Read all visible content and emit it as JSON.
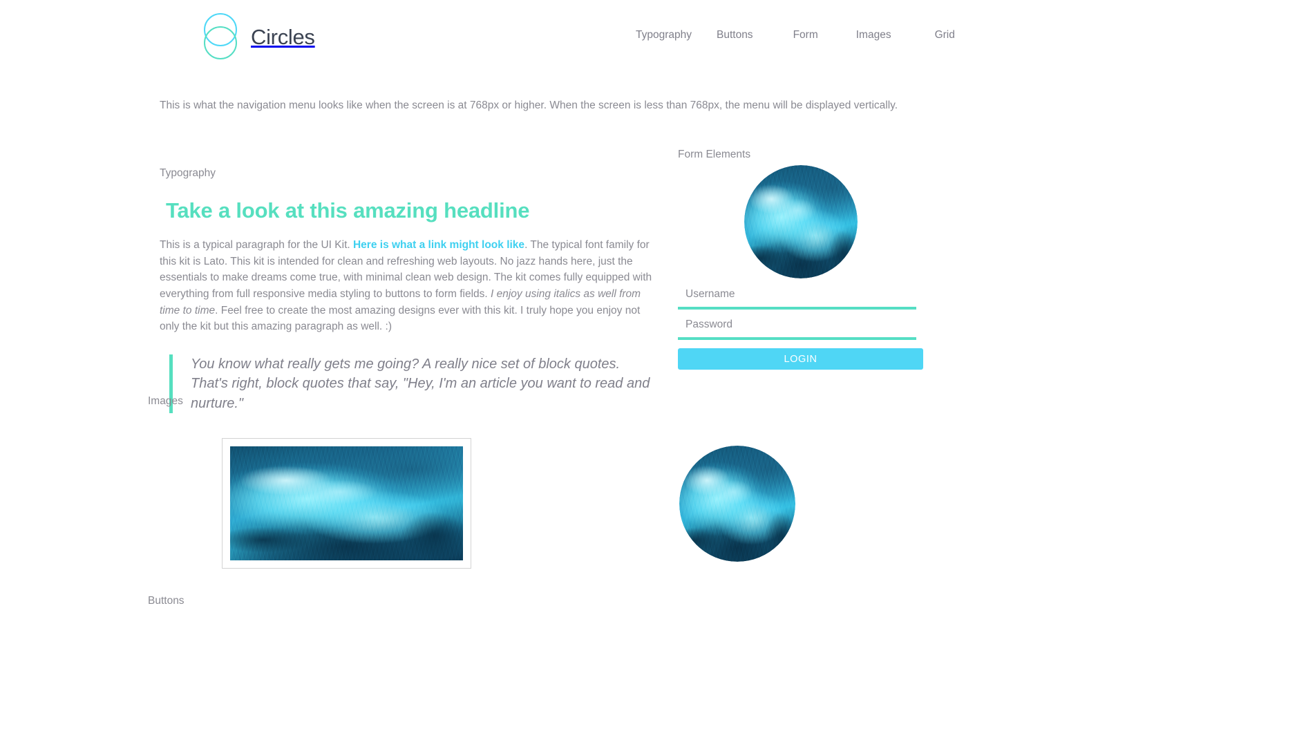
{
  "brand": {
    "name": "Circles",
    "logo_icon": "two-overlapping-circles-icon",
    "logo_top_color": "#4ed8f7",
    "logo_bottom_color": "#55dec4"
  },
  "nav": {
    "items": [
      {
        "label": "Typography"
      },
      {
        "label": "Buttons"
      },
      {
        "label": "Form"
      },
      {
        "label": "Images"
      },
      {
        "label": "Grid"
      }
    ]
  },
  "intro": {
    "text": "This is what the navigation menu looks like when the screen is at 768px or higher. When the screen is less than 768px, the menu will be displayed vertically."
  },
  "typography": {
    "section_label": "Typography",
    "headline": "Take a look at this amazing headline",
    "paragraph": {
      "part1": "This is a typical paragraph for the UI Kit. ",
      "link_text": "Here is what a link might look like",
      "part2": ". The typical font family for this kit is Lato. This kit is intended for clean and refreshing web layouts. No jazz hands here, just the essentials to make dreams come true, with minimal clean web design. The kit comes fully equipped with everything from full responsive media styling to buttons to form fields. ",
      "italic_text": "I enjoy using italics as well from time to time",
      "part3": ". Feel free to create the most amazing designs ever with this kit. I truly hope you enjoy not only the kit but this amazing paragraph as well. :)"
    },
    "blockquote": "You know what really gets me going? A really nice set of block quotes. That's right, block quotes that say, \"Hey, I'm an article you want to read and nurture.\""
  },
  "form": {
    "section_label": "Form Elements",
    "avatar_icon": "circular-wave-photo",
    "username": {
      "label": "Username",
      "value": "",
      "placeholder": "Username"
    },
    "password": {
      "label": "Password",
      "value": "",
      "placeholder": "Password"
    },
    "login_label": "LOGIN",
    "button_color": "#4fd6f5",
    "underline_color": "#55dec4"
  },
  "images": {
    "section_label": "Images",
    "framed_image_icon": "framed-wave-photo",
    "circular_image_icon": "circular-wave-photo"
  },
  "buttons": {
    "section_label": "Buttons"
  },
  "colors": {
    "accent_cyan": "#4fd6f5",
    "accent_mint": "#56dfbf",
    "text_gray": "#8a8a92",
    "brand_dark": "#3b4352"
  }
}
